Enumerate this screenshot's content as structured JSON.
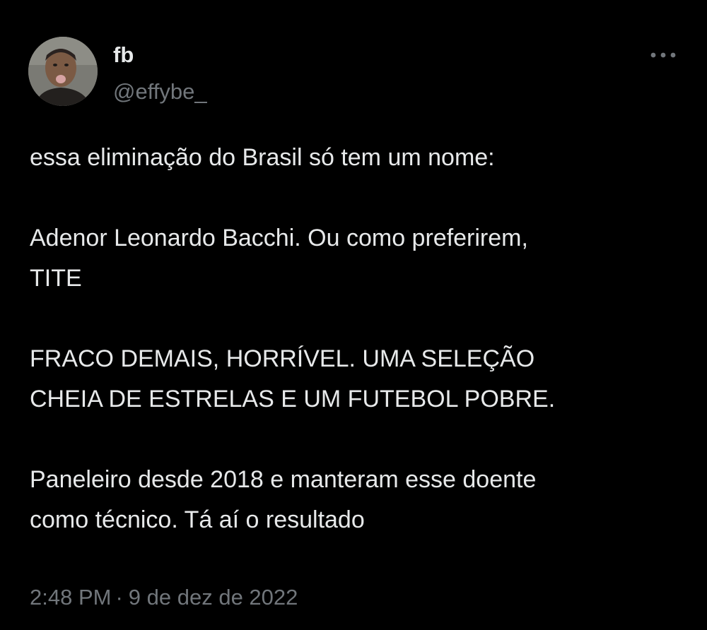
{
  "author": {
    "display_name": "fb",
    "handle": "@effybe_",
    "avatar_icon": "profile-photo"
  },
  "menu": {
    "icon": "more-horizontal-icon"
  },
  "tweet": {
    "line_1": "essa eliminação do Brasil só tem um nome:",
    "line_2": "Adenor Leonardo Bacchi. Ou como preferirem,",
    "line_3": "TITE",
    "line_4": "FRACO DEMAIS, HORRÍVEL. UMA SELEÇÃO",
    "line_5": "CHEIA DE ESTRELAS E UM FUTEBOL POBRE.",
    "line_6": "Paneleiro desde 2018 e manteram esse doente",
    "line_7": "como técnico. Tá aí o resultado"
  },
  "meta": {
    "time": "2:48 PM",
    "separator": "·",
    "date": "9 de dez de 2022"
  },
  "colors": {
    "background": "#000000",
    "primary_text": "#e7e9ea",
    "secondary_text": "#71767b"
  }
}
